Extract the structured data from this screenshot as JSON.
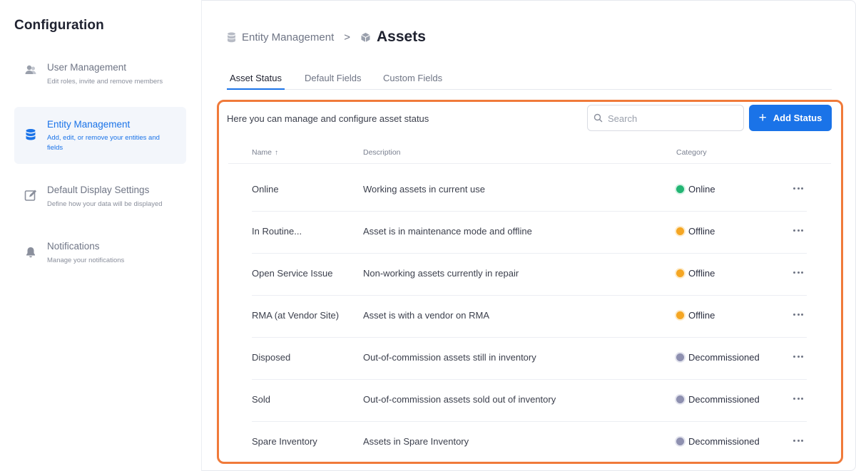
{
  "sidebar": {
    "title": "Configuration",
    "items": [
      {
        "label": "User Management",
        "desc": "Edit roles, invite and remove members",
        "icon": "users-icon"
      },
      {
        "label": "Entity Management",
        "desc": "Add, edit, or remove your entities and fields",
        "icon": "database-icon",
        "active": true
      },
      {
        "label": "Default Display Settings",
        "desc": "Define how your data will be displayed",
        "icon": "edit-icon"
      },
      {
        "label": "Notifications",
        "desc": "Manage your notifications",
        "icon": "bell-icon"
      }
    ]
  },
  "breadcrumb": {
    "parent": "Entity Management",
    "separator": ">",
    "current": "Assets",
    "parent_icon": "database-icon",
    "current_icon": "cube-icon"
  },
  "tabs": [
    {
      "label": "Asset Status",
      "active": true
    },
    {
      "label": "Default Fields"
    },
    {
      "label": "Custom Fields"
    }
  ],
  "panel": {
    "intro": "Here you can manage and configure asset status",
    "search_placeholder": "Search",
    "add_button": "Add Status",
    "add_icon": "+"
  },
  "table": {
    "columns": {
      "name": "Name",
      "name_sort_icon": "↑",
      "description": "Description",
      "category": "Category"
    },
    "rows": [
      {
        "name": "Online",
        "description": "Working assets in current use",
        "category": "Online",
        "color": "#22b573"
      },
      {
        "name": "In Routine...",
        "description": "Asset is in maintenance mode and offline",
        "category": "Offline",
        "color": "#f5a623"
      },
      {
        "name": "Open Service Issue",
        "description": "Non-working assets currently in repair",
        "category": "Offline",
        "color": "#f5a623"
      },
      {
        "name": "RMA (at Vendor Site)",
        "description": "Asset is with a vendor on RMA",
        "category": "Offline",
        "color": "#f5a623"
      },
      {
        "name": "Disposed",
        "description": "Out-of-commission assets still in inventory",
        "category": "Decommissioned",
        "color": "#8e90b0"
      },
      {
        "name": "Sold",
        "description": "Out-of-commission assets sold out of inventory",
        "category": "Decommissioned",
        "color": "#8e90b0"
      },
      {
        "name": "Spare Inventory",
        "description": "Assets in Spare Inventory",
        "category": "Decommissioned",
        "color": "#8e90b0"
      }
    ]
  },
  "colors": {
    "accent": "#1a73e8",
    "highlight_border": "#f07a3a"
  }
}
